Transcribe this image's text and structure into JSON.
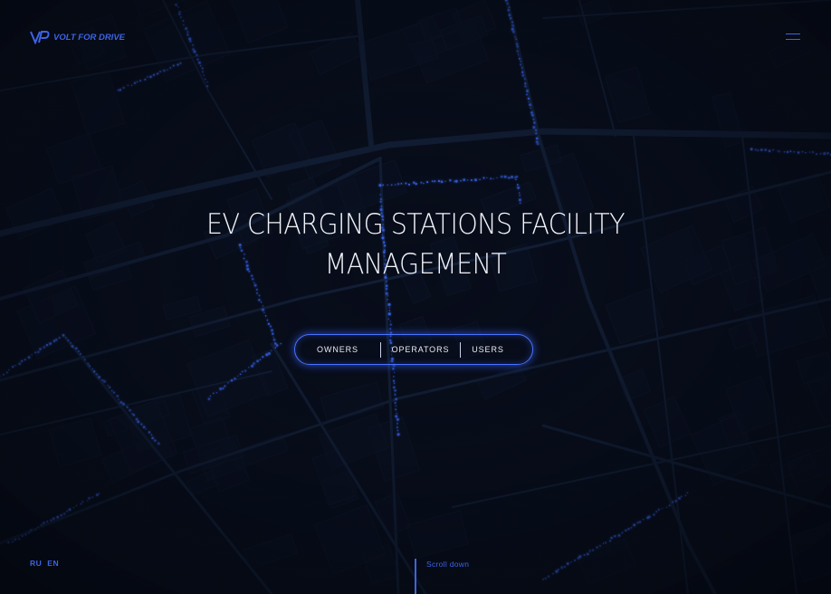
{
  "brand": {
    "name": "VOLT FOR DRIVE",
    "icon": "vp-logo-icon",
    "accent": "#3d63e6"
  },
  "header": {
    "menu_icon": "hamburger-menu-icon"
  },
  "hero": {
    "title_line1": "EV CHARGING STATIONS FACILITY",
    "title_line2": "MANAGEMENT"
  },
  "audience": {
    "options": [
      "OWNERS",
      "OPERATORS",
      "USERS"
    ],
    "border_color": "#4a73ff"
  },
  "languages": [
    "RU",
    "EN"
  ],
  "scroll": {
    "label": "Scroll down"
  },
  "colors": {
    "background": "#070b16",
    "road": "#142038",
    "glow": "#3a6bff"
  }
}
